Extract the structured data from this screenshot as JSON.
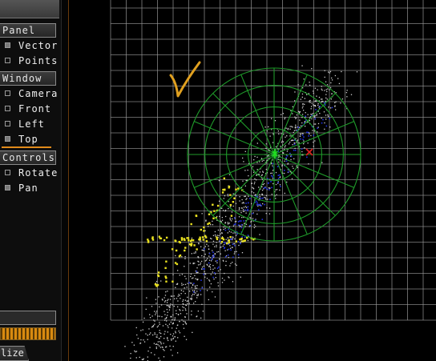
{
  "sidebar": {
    "panel": {
      "header": "Panel",
      "items": [
        {
          "label": "Vector",
          "checked": true
        },
        {
          "label": "Points",
          "checked": false
        }
      ]
    },
    "window": {
      "header": "Window",
      "items": [
        {
          "label": "Camera",
          "checked": false
        },
        {
          "label": "Front",
          "checked": false
        },
        {
          "label": "Left",
          "checked": false
        },
        {
          "label": "Top",
          "checked": true
        }
      ]
    },
    "controls": {
      "header": "Controls",
      "items": [
        {
          "label": "Rotate",
          "checked": false
        },
        {
          "label": "Pan",
          "checked": true
        }
      ]
    },
    "bottom_tab_label": "lize"
  },
  "viewport": {
    "annotation_mark": "V",
    "colors": {
      "grid": "#9a9a9a",
      "sphere": "#1f9a2a",
      "points_white": "#cfcfcf",
      "points_yellow": "#e8e020",
      "points_blue": "#2030e0",
      "marker_red": "#e02020",
      "marker_green": "#20e020",
      "annotation": "#e0a020"
    }
  }
}
